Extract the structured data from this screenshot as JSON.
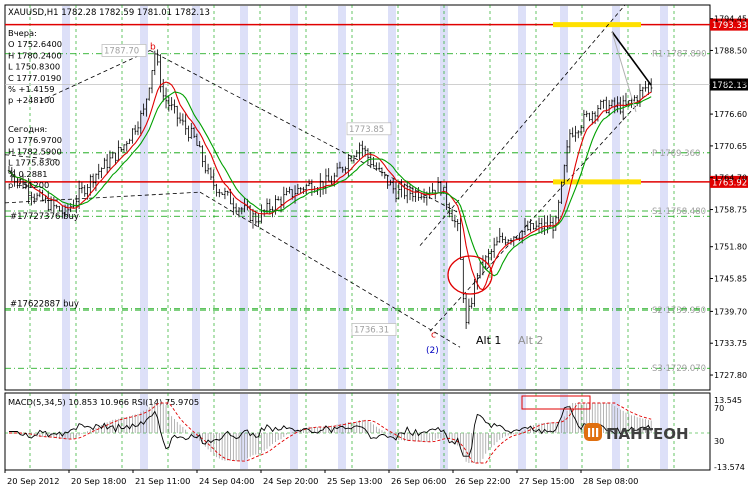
{
  "header": {
    "symbol": "XAUUSD,H1",
    "ohlc": "1782.28 1782.59 1781.01 1782.13"
  },
  "info_yesterday": [
    "Вчера:",
    "O 1752.6400",
    "H 1780.2400",
    "L 1750.8300",
    "C 1777.0190",
    "% +1.4159",
    "p +248100"
  ],
  "info_today": [
    "Сегодня:",
    "O 1776.9700",
    "H 1782.5900",
    "L 1775.8300",
    "% 0.2881",
    "p +51200"
  ],
  "trade_labels": {
    "buy1": "#17727376 buy",
    "buy2": "#17622887 buy"
  },
  "wave_labels": {
    "b": "b",
    "c": "c",
    "c2": "(2)",
    "alt1": "Alt 1",
    "alt2": "Alt 2"
  },
  "price_tags": {
    "top_left": "1787.70",
    "mid": "1773.85",
    "low": "1736.31"
  },
  "pivots": [
    {
      "label": "R1 1787.890",
      "value": 1787.89
    },
    {
      "label": "P 1769.360",
      "value": 1769.36
    },
    {
      "label": "S1 1758.480",
      "value": 1758.48
    },
    {
      "label": "S2 1739.950",
      "value": 1739.95
    },
    {
      "label": "S3 1729.070",
      "value": 1729.07
    }
  ],
  "levels": [
    {
      "label": "1793.33",
      "value": 1793.33,
      "color": "#e00000"
    },
    {
      "label": "1763.92",
      "value": 1763.92,
      "color": "#e00000"
    }
  ],
  "current_price": {
    "label": "1782.13",
    "value": 1782.13
  },
  "macd_header": "MACD(5,34,5) 10.853 10.966  RSI(14) 75.9705",
  "macd_axis": [
    "13.545",
    "70",
    "30",
    "-13.574"
  ],
  "logo_text": "ПАНТЕОН",
  "colors": {
    "candle": "#000000",
    "ma_fast": "#e00000",
    "ma_slow": "#00a000",
    "level": "#e00000",
    "highlight": "#ffe000",
    "session": "#dde0f8",
    "logo": "#e07010"
  },
  "chart_data": {
    "type": "candlestick",
    "symbol": "XAUUSD",
    "timeframe": "H1",
    "ylim": [
      1725,
      1797
    ],
    "y_ticks": [
      1794.45,
      1788.5,
      1782.55,
      1776.6,
      1770.65,
      1764.7,
      1758.75,
      1751.8,
      1745.85,
      1739.7,
      1733.75,
      1727.8
    ],
    "x_ticks": [
      "20 Sep 2012",
      "20 Sep 18:00",
      "21 Sep 11:00",
      "24 Sep 04:00",
      "24 Sep 20:00",
      "25 Sep 13:00",
      "26 Sep 06:00",
      "26 Sep 22:00",
      "27 Sep 15:00",
      "28 Sep 08:00"
    ],
    "close_path": [
      {
        "i": 0,
        "v": 1766
      },
      {
        "i": 10,
        "v": 1761
      },
      {
        "i": 20,
        "v": 1758
      },
      {
        "i": 30,
        "v": 1765
      },
      {
        "i": 40,
        "v": 1770
      },
      {
        "i": 48,
        "v": 1777
      },
      {
        "i": 52,
        "v": 1788
      },
      {
        "i": 55,
        "v": 1780
      },
      {
        "i": 60,
        "v": 1776
      },
      {
        "i": 66,
        "v": 1772
      },
      {
        "i": 72,
        "v": 1764
      },
      {
        "i": 80,
        "v": 1760
      },
      {
        "i": 88,
        "v": 1757
      },
      {
        "i": 95,
        "v": 1760
      },
      {
        "i": 105,
        "v": 1763
      },
      {
        "i": 115,
        "v": 1764
      },
      {
        "i": 125,
        "v": 1771
      },
      {
        "i": 130,
        "v": 1767
      },
      {
        "i": 138,
        "v": 1762
      },
      {
        "i": 146,
        "v": 1762
      },
      {
        "i": 154,
        "v": 1763
      },
      {
        "i": 160,
        "v": 1755
      },
      {
        "i": 163,
        "v": 1737
      },
      {
        "i": 167,
        "v": 1747
      },
      {
        "i": 175,
        "v": 1753
      },
      {
        "i": 185,
        "v": 1755
      },
      {
        "i": 195,
        "v": 1756
      },
      {
        "i": 200,
        "v": 1773
      },
      {
        "i": 210,
        "v": 1778
      },
      {
        "i": 220,
        "v": 1778
      },
      {
        "i": 228,
        "v": 1782
      }
    ],
    "bars": 230,
    "series": [
      {
        "name": "MACD(5,34,5)",
        "value": 10.853,
        "signal": 10.966
      },
      {
        "name": "RSI(14)",
        "value": 75.9705
      }
    ]
  }
}
